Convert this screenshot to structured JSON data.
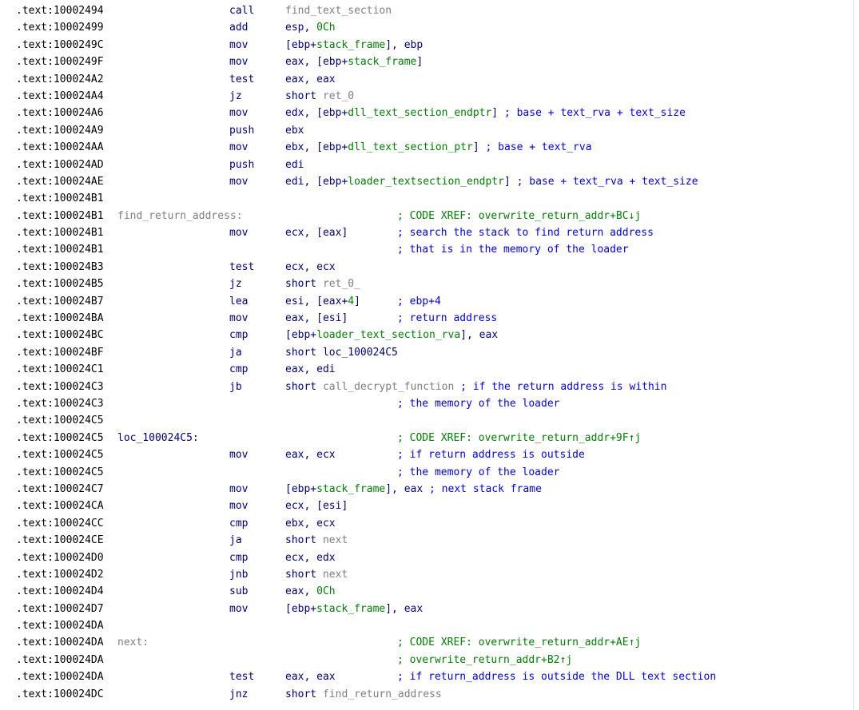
{
  "segment": ".text",
  "rows": [
    {
      "addr": ".text:10002494",
      "mnem": "call",
      "ops": [
        {
          "t": "find_text_section",
          "k": "loc"
        }
      ]
    },
    {
      "addr": ".text:10002499",
      "mnem": "add",
      "ops": [
        {
          "t": "esp, ",
          "k": "plain"
        },
        {
          "t": "0Ch",
          "k": "num"
        }
      ]
    },
    {
      "addr": ".text:1000249C",
      "mnem": "mov",
      "ops": [
        {
          "t": "[ebp+",
          "k": "plain"
        },
        {
          "t": "stack_frame",
          "k": "var"
        },
        {
          "t": "], ebp",
          "k": "plain"
        }
      ]
    },
    {
      "addr": ".text:1000249F",
      "mnem": "mov",
      "ops": [
        {
          "t": "eax, [ebp+",
          "k": "plain"
        },
        {
          "t": "stack_frame",
          "k": "var"
        },
        {
          "t": "]",
          "k": "plain"
        }
      ]
    },
    {
      "addr": ".text:100024A2",
      "mnem": "test",
      "ops": [
        {
          "t": "eax, eax",
          "k": "plain"
        }
      ]
    },
    {
      "addr": ".text:100024A4",
      "mnem": "jz",
      "ops": [
        {
          "t": "short ",
          "k": "plain"
        },
        {
          "t": "ret_0",
          "k": "loc"
        }
      ]
    },
    {
      "addr": ".text:100024A6",
      "mnem": "mov",
      "ops": [
        {
          "t": "edx, [ebp+",
          "k": "plain"
        },
        {
          "t": "dll_text_section_endptr",
          "k": "var"
        },
        {
          "t": "] ",
          "k": "plain"
        }
      ],
      "comment": "; base + text_rva + text_size"
    },
    {
      "addr": ".text:100024A9",
      "mnem": "push",
      "ops": [
        {
          "t": "ebx",
          "k": "plain"
        }
      ]
    },
    {
      "addr": ".text:100024AA",
      "mnem": "mov",
      "ops": [
        {
          "t": "ebx, [ebp+",
          "k": "plain"
        },
        {
          "t": "dll_text_section_ptr",
          "k": "var"
        },
        {
          "t": "] ",
          "k": "plain"
        }
      ],
      "comment": "; base + text_rva"
    },
    {
      "addr": ".text:100024AD",
      "mnem": "push",
      "ops": [
        {
          "t": "edi",
          "k": "plain"
        }
      ]
    },
    {
      "addr": ".text:100024AE",
      "mnem": "mov",
      "ops": [
        {
          "t": "edi, [ebp+",
          "k": "plain"
        },
        {
          "t": "loader_textsection_endptr",
          "k": "var"
        },
        {
          "t": "] ",
          "k": "plain"
        }
      ],
      "comment": "; base + text_rva + text_size"
    },
    {
      "addr": ".text:100024B1"
    },
    {
      "addr": ".text:100024B1",
      "label": "find_return_address:",
      "labelKind": "loc",
      "xref": "; CODE XREF: overwrite_return_addr+BC↓j"
    },
    {
      "addr": ".text:100024B1",
      "mnem": "mov",
      "ops": [
        {
          "t": "ecx, [eax]",
          "k": "plain"
        }
      ],
      "comment": "; search the stack to find return address",
      "cmtCol": 497
    },
    {
      "addr": ".text:100024B1",
      "comment": "; that is in the memory of the loader",
      "cmtCol": 497
    },
    {
      "addr": ".text:100024B3",
      "mnem": "test",
      "ops": [
        {
          "t": "ecx, ecx",
          "k": "plain"
        }
      ]
    },
    {
      "addr": ".text:100024B5",
      "mnem": "jz",
      "ops": [
        {
          "t": "short ",
          "k": "plain"
        },
        {
          "t": "ret_0_",
          "k": "loc"
        }
      ]
    },
    {
      "addr": ".text:100024B7",
      "mnem": "lea",
      "ops": [
        {
          "t": "esi, [eax+",
          "k": "plain"
        },
        {
          "t": "4",
          "k": "num"
        },
        {
          "t": "]",
          "k": "plain"
        }
      ],
      "comment": "; ebp+4",
      "cmtCol": 497
    },
    {
      "addr": ".text:100024BA",
      "mnem": "mov",
      "ops": [
        {
          "t": "eax, [esi]",
          "k": "plain"
        }
      ],
      "comment": "; return address",
      "cmtCol": 497
    },
    {
      "addr": ".text:100024BC",
      "mnem": "cmp",
      "ops": [
        {
          "t": "[ebp+",
          "k": "plain"
        },
        {
          "t": "loader_text_section_rva",
          "k": "var"
        },
        {
          "t": "], eax",
          "k": "plain"
        }
      ]
    },
    {
      "addr": ".text:100024BF",
      "mnem": "ja",
      "ops": [
        {
          "t": "short loc_100024C5",
          "k": "plain"
        }
      ]
    },
    {
      "addr": ".text:100024C1",
      "mnem": "cmp",
      "ops": [
        {
          "t": "eax, edi",
          "k": "plain"
        }
      ]
    },
    {
      "addr": ".text:100024C3",
      "mnem": "jb",
      "ops": [
        {
          "t": "short ",
          "k": "plain"
        },
        {
          "t": "call_decrypt_function",
          "k": "loc"
        },
        {
          "t": " ",
          "k": "plain"
        }
      ],
      "comment": "; if the return address is within"
    },
    {
      "addr": ".text:100024C3",
      "comment": "; the memory of the loader",
      "cmtCol": 497
    },
    {
      "addr": ".text:100024C5"
    },
    {
      "addr": ".text:100024C5",
      "label": "loc_100024C5:",
      "labelKind": "def",
      "xref": "; CODE XREF: overwrite_return_addr+9F↑j"
    },
    {
      "addr": ".text:100024C5",
      "mnem": "mov",
      "ops": [
        {
          "t": "eax, ecx",
          "k": "plain"
        }
      ],
      "comment": "; if return address is outside",
      "cmtCol": 497
    },
    {
      "addr": ".text:100024C5",
      "comment": "; the memory of the loader",
      "cmtCol": 497
    },
    {
      "addr": ".text:100024C7",
      "mnem": "mov",
      "ops": [
        {
          "t": "[ebp+",
          "k": "plain"
        },
        {
          "t": "stack_frame",
          "k": "var"
        },
        {
          "t": "], eax ",
          "k": "plain"
        }
      ],
      "comment": "; next stack frame"
    },
    {
      "addr": ".text:100024CA",
      "mnem": "mov",
      "ops": [
        {
          "t": "ecx, [esi]",
          "k": "plain"
        }
      ]
    },
    {
      "addr": ".text:100024CC",
      "mnem": "cmp",
      "ops": [
        {
          "t": "ebx, ecx",
          "k": "plain"
        }
      ]
    },
    {
      "addr": ".text:100024CE",
      "mnem": "ja",
      "ops": [
        {
          "t": "short ",
          "k": "plain"
        },
        {
          "t": "next",
          "k": "loc"
        }
      ]
    },
    {
      "addr": ".text:100024D0",
      "mnem": "cmp",
      "ops": [
        {
          "t": "ecx, edx",
          "k": "plain"
        }
      ]
    },
    {
      "addr": ".text:100024D2",
      "mnem": "jnb",
      "ops": [
        {
          "t": "short ",
          "k": "plain"
        },
        {
          "t": "next",
          "k": "loc"
        }
      ]
    },
    {
      "addr": ".text:100024D4",
      "mnem": "sub",
      "ops": [
        {
          "t": "eax, ",
          "k": "plain"
        },
        {
          "t": "0Ch",
          "k": "num"
        }
      ]
    },
    {
      "addr": ".text:100024D7",
      "mnem": "mov",
      "ops": [
        {
          "t": "[ebp+",
          "k": "plain"
        },
        {
          "t": "stack_frame",
          "k": "var"
        },
        {
          "t": "], eax",
          "k": "plain"
        }
      ]
    },
    {
      "addr": ".text:100024DA"
    },
    {
      "addr": ".text:100024DA",
      "label": "next:",
      "labelKind": "loc",
      "xref": "; CODE XREF: overwrite_return_addr+AE↑j"
    },
    {
      "addr": ".text:100024DA",
      "xref": "; overwrite_return_addr+B2↑j"
    },
    {
      "addr": ".text:100024DA",
      "mnem": "test",
      "ops": [
        {
          "t": "eax, eax",
          "k": "plain"
        }
      ],
      "comment": "; if return_address is outside the DLL text section",
      "cmtCol": 497
    },
    {
      "addr": ".text:100024DC",
      "mnem": "jnz",
      "ops": [
        {
          "t": "short ",
          "k": "plain"
        },
        {
          "t": "find_return_address",
          "k": "loc"
        }
      ]
    }
  ]
}
